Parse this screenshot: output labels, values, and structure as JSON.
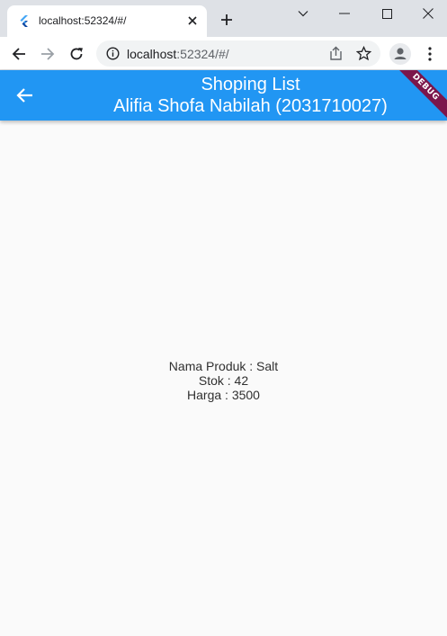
{
  "browser": {
    "tab_title": "localhost:52324/#/",
    "url_host": "localhost",
    "url_rest": ":52324/#/",
    "icons": {
      "favicon": "flutter-icon",
      "tab_close": "close-icon",
      "new_tab": "plus-icon",
      "back": "arrow-left-icon",
      "forward": "arrow-right-icon",
      "reload": "reload-icon",
      "info": "info-icon",
      "share": "share-icon",
      "star": "star-icon",
      "profile": "profile-icon",
      "menu": "kebab-menu-icon"
    }
  },
  "appbar": {
    "title_line1": "Shoping List",
    "title_line2": "Alifia Shofa Nabilah (2031710027)",
    "debug_label": "DEBUG",
    "color": "#2196f3"
  },
  "product": {
    "name_line": "Nama Produk : Salt",
    "stock_line": "Stok : 42",
    "price_line": "Harga : 3500"
  }
}
